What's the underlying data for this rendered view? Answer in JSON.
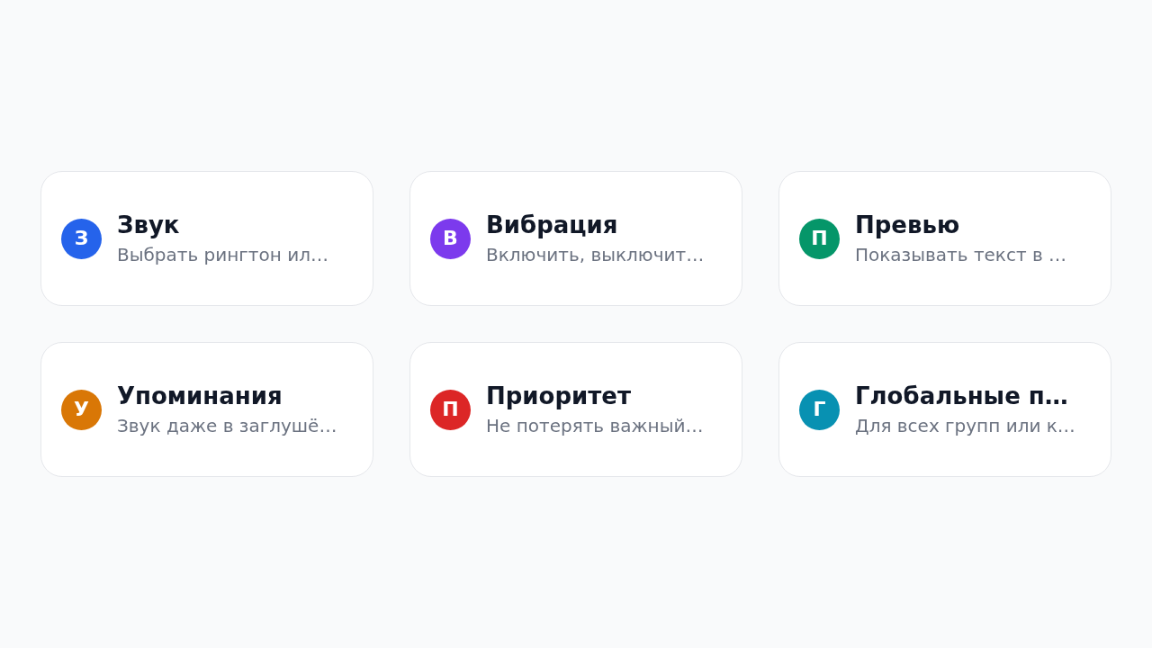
{
  "cards": [
    {
      "initial": "З",
      "color": "#2563eb",
      "title": "Звук",
      "subtitle": "Выбрать рингтон ил…"
    },
    {
      "initial": "В",
      "color": "#7c3aed",
      "title": "Вибрация",
      "subtitle": "Включить, выключит…"
    },
    {
      "initial": "П",
      "color": "#059669",
      "title": "Превью",
      "subtitle": "Показывать текст в …"
    },
    {
      "initial": "У",
      "color": "#d97706",
      "title": "Упоминания",
      "subtitle": "Звук даже в заглушё…"
    },
    {
      "initial": "П",
      "color": "#dc2626",
      "title": "Приоритет",
      "subtitle": "Не потерять важный…"
    },
    {
      "initial": "Г",
      "color": "#0891b2",
      "title": "Глобальные п…",
      "subtitle": "Для всех групп или к…"
    }
  ]
}
